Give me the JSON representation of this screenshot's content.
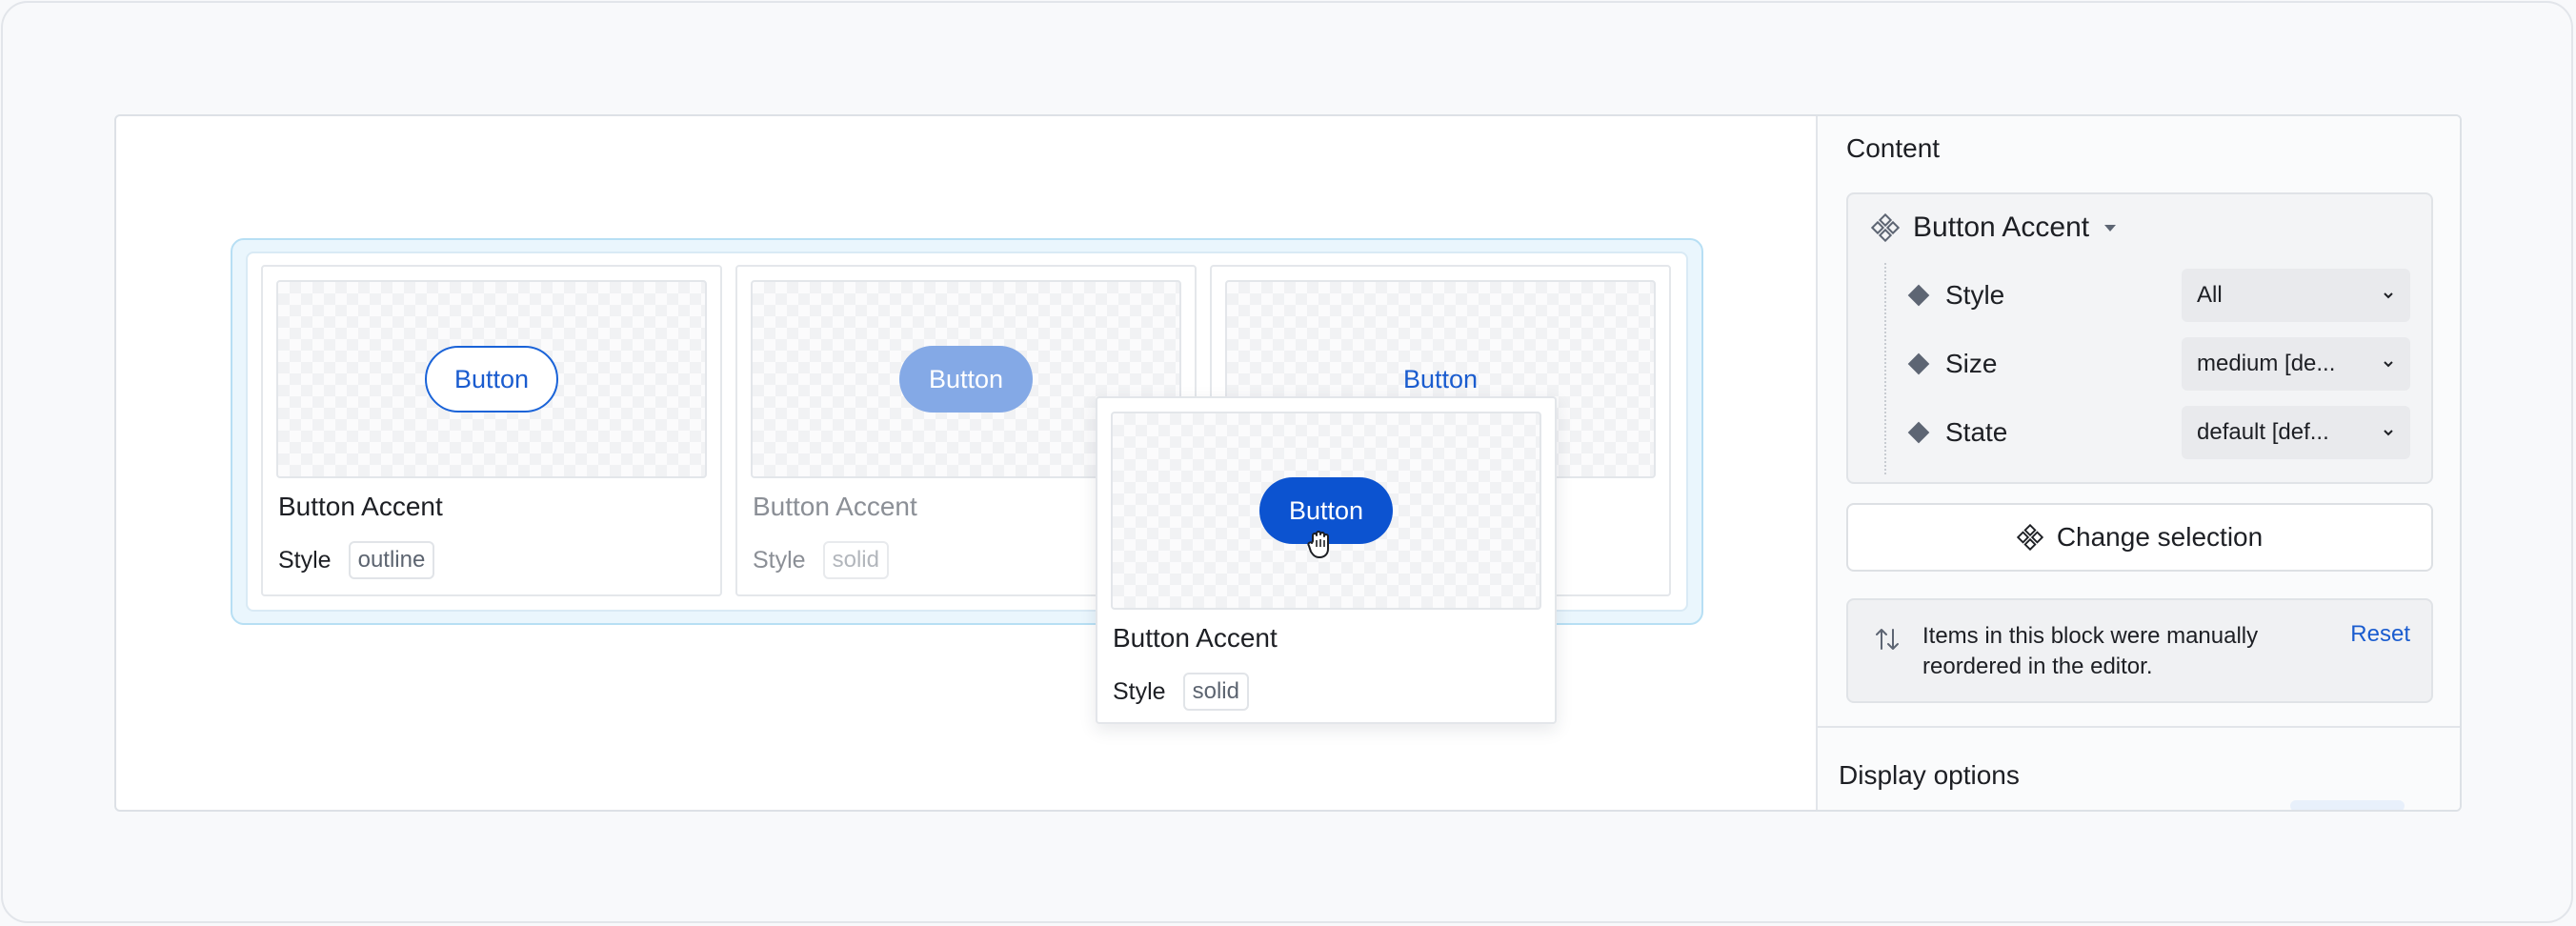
{
  "canvas": {
    "cards": [
      {
        "button_label": "Button",
        "title": "Button Accent",
        "meta_label": "Style",
        "tag": "outline"
      },
      {
        "button_label": "Button",
        "title": "Button Accent",
        "meta_label": "Style",
        "tag": "solid"
      },
      {
        "button_label": "Button"
      }
    ],
    "drag_card": {
      "button_label": "Button",
      "title": "Button Accent",
      "meta_label": "Style",
      "tag": "solid"
    }
  },
  "panel": {
    "heading": "Content",
    "component": {
      "name": "Button Accent",
      "icon": "component-icon",
      "properties": [
        {
          "label": "Style",
          "value": "All"
        },
        {
          "label": "Size",
          "value": "medium [de..."
        },
        {
          "label": "State",
          "value": "default [def..."
        }
      ]
    },
    "change_selection_label": "Change selection",
    "notice": {
      "text": "Items in this block were manually reordered in the editor.",
      "action": "Reset"
    },
    "display_heading": "Display options"
  },
  "colors": {
    "accent": "#0c53d0",
    "accent_ghost": "#84a9e6",
    "link": "#1a5ccf",
    "block_bg": "#eaf6fd",
    "block_border": "#b7dff4"
  }
}
